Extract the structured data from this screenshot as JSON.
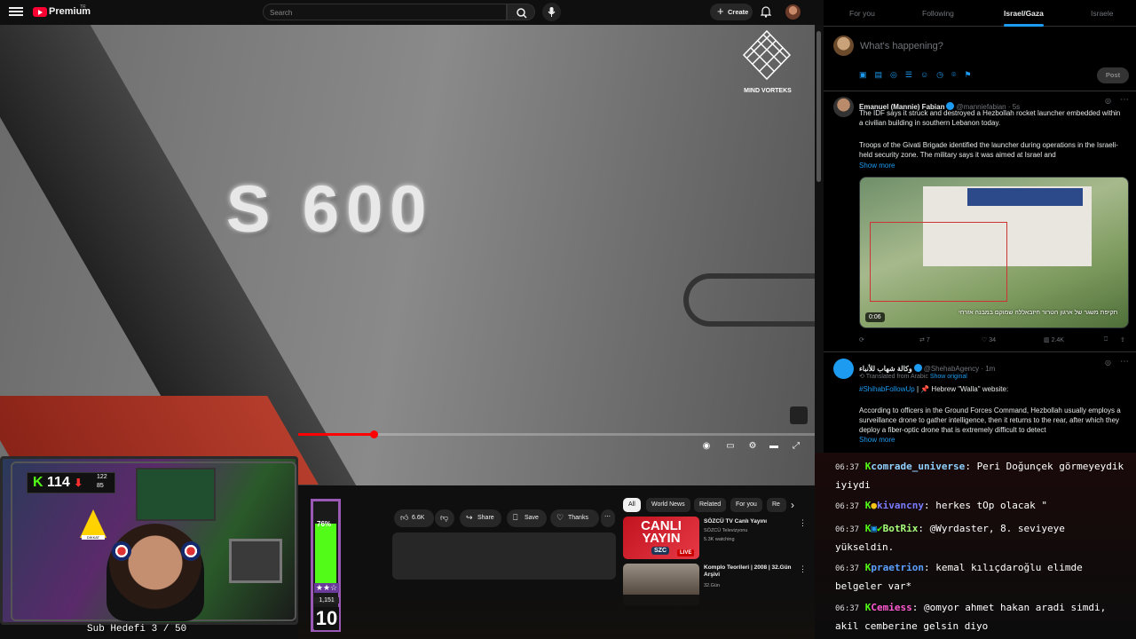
{
  "youtube": {
    "brand": "Premium",
    "region": "TR",
    "search_placeholder": "Search",
    "create_label": "Create",
    "video": {
      "overlay_text": "S 600",
      "watermark": "MIND VORTEKS",
      "progress_fraction": 0.148
    },
    "actions": {
      "likes": "6.6K",
      "share": "Share",
      "save": "Save",
      "thanks": "Thanks"
    },
    "chips": [
      "All",
      "World News",
      "Related",
      "For you",
      "Re"
    ],
    "recommendations": [
      {
        "title": "SÖZCÜ TV Canlı Yayını",
        "channel": "SÖZCÜ Televizyonu",
        "meta": "5.3K watching",
        "badge": "LIVE",
        "thumb_text": "CANLI YAYIN",
        "thumb_logo": "SZC"
      },
      {
        "title": "Komplo Teorileri | 2008 | 32.Gün Arşivi",
        "channel": "32.Gün",
        "meta": ""
      }
    ]
  },
  "stream_overlay": {
    "kick_count": "114",
    "stat_top": "122",
    "stat_bottom": "85",
    "warning_label": "DİKKAT",
    "sub_goal": "Sub Hedefi 3 / 50",
    "goal_percent": "76%",
    "goal_fraction": 0.76,
    "goal_stars": "★★☆",
    "goal_count": "1,151",
    "goal_level": "10"
  },
  "x": {
    "tabs": [
      {
        "label": "For you"
      },
      {
        "label": "Following"
      },
      {
        "label": "Israel/Gaza"
      },
      {
        "label": "Israele"
      }
    ],
    "compose_placeholder": "What's happening?",
    "post_label": "Post",
    "posts": [
      {
        "name": "Emanuel (Mannie) Fabian",
        "handle": "@manniefabian · 5s",
        "body1": "The IDF says it struck and destroyed a Hezbollah rocket launcher embedded within a civilian building in southern Lebanon today.",
        "body2": "Troops of the Givati Brigade identified the launcher during operations in the Israeli-held security zone. The military says it was aimed at Israel and",
        "more": "Show more",
        "media_duration": "0:06",
        "media_caption": "תקיפת משגר של ארגון הטרור חיזבאללה שמוקם במבנה אזרחי",
        "reposts": "7",
        "likes": "34",
        "views": "2.4K"
      },
      {
        "name": "وكالة شهاب للأنباء",
        "handle": "@ShehabAgency · 1m",
        "translated": "Translated from Arabic",
        "show_original": "Show original",
        "hashtag": "#ShihabFollowUp",
        "line1": "| 📌 Hebrew \"Walla\" website:",
        "body": "According to officers in the Ground Forces Command, Hezbollah usually employs a surveillance drone to gather intelligence, then it returns to the rear, after which they deploy a fiber-optic drone that is extremely difficult to detect",
        "more": "Show more"
      }
    ]
  },
  "chat": [
    {
      "time": "06:37",
      "user": "comrade_universe",
      "color": "#8fd0ff",
      "text": "Peri Doğunçek görmeyeydik iyiydi"
    },
    {
      "time": "06:37",
      "user": "kivancny",
      "color": "#7a7cff",
      "text": "herkes tOp olacak \""
    },
    {
      "time": "06:37",
      "user": "BotRix",
      "color": "#a7ff7a",
      "text": "@Wyrdaster, 8. seviyeye yükseldin."
    },
    {
      "time": "06:37",
      "user": "praetrion",
      "color": "#5aa0ff",
      "text": "kemal kılıçdaroğlu elimde belgeler var*"
    },
    {
      "time": "06:37",
      "user": "Cemiess",
      "color": "#ff5ad0",
      "text": "@omyor ahmet hakan aradi simdi, akil cemberine gelsin diyo"
    }
  ]
}
